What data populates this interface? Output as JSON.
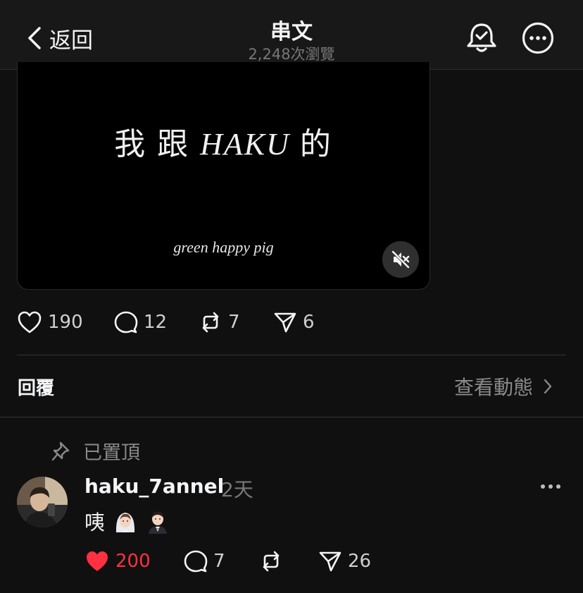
{
  "header": {
    "back_label": "返回",
    "title": "串文",
    "views": "2,248次瀏覽"
  },
  "video": {
    "text_prefix": "我 跟 ",
    "text_italic": "HAKU",
    "text_suffix": " 的",
    "subtitle": "green happy pig"
  },
  "post_actions": {
    "likes": "190",
    "comments": "12",
    "reposts": "7",
    "shares": "6"
  },
  "replies_section": {
    "title": "回覆",
    "view_activity": "查看動態"
  },
  "reply": {
    "pinned_label": "已置頂",
    "username": "haku_7annel",
    "time": "2天",
    "text": "咦",
    "likes": "200",
    "comments": "7",
    "shares": "26"
  },
  "colors": {
    "background": "#101010",
    "header": "#181818",
    "like_active": "#ff3040",
    "muted_text": "#777777"
  }
}
